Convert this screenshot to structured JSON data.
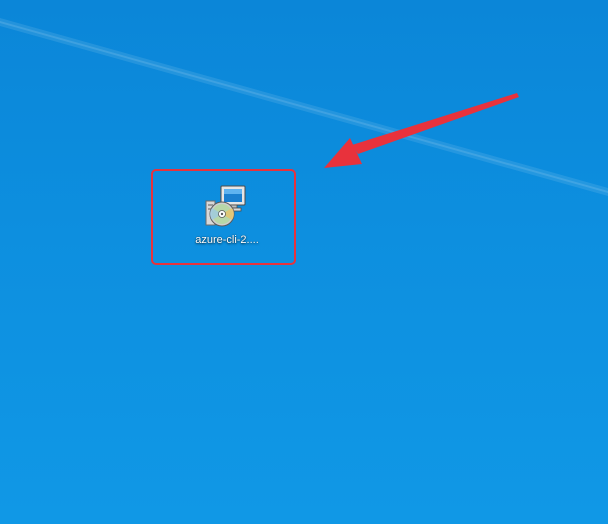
{
  "desktop": {
    "background_color": "#0d8fdf",
    "icons": [
      {
        "label": "azure-cli-2....",
        "icon": "installer-package-icon"
      }
    ]
  },
  "annotation": {
    "highlight_color": "#e8323c",
    "arrow_color": "#e8323c"
  }
}
